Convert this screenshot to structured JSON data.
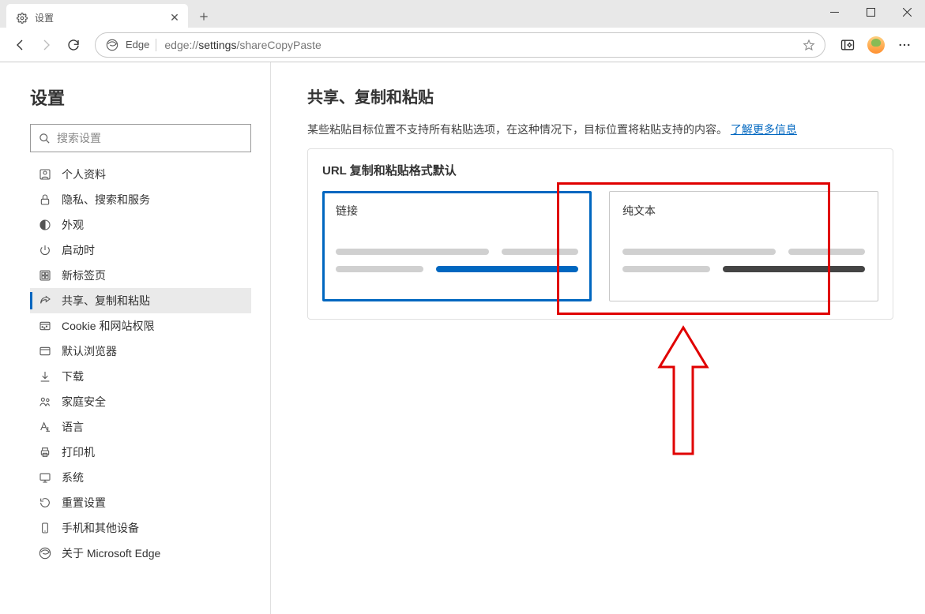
{
  "window": {
    "tab_title": "设置"
  },
  "toolbar": {
    "edge_label": "Edge",
    "url_prefix": "edge://",
    "url_bold": "settings",
    "url_suffix": "/shareCopyPaste"
  },
  "sidebar": {
    "title": "设置",
    "search_placeholder": "搜索设置",
    "items": [
      {
        "label": "个人资料",
        "icon": "profile"
      },
      {
        "label": "隐私、搜索和服务",
        "icon": "lock"
      },
      {
        "label": "外观",
        "icon": "appearance"
      },
      {
        "label": "启动时",
        "icon": "power"
      },
      {
        "label": "新标签页",
        "icon": "grid"
      },
      {
        "label": "共享、复制和粘贴",
        "icon": "share"
      },
      {
        "label": "Cookie 和网站权限",
        "icon": "cookie"
      },
      {
        "label": "默认浏览器",
        "icon": "browser"
      },
      {
        "label": "下载",
        "icon": "download"
      },
      {
        "label": "家庭安全",
        "icon": "family"
      },
      {
        "label": "语言",
        "icon": "language"
      },
      {
        "label": "打印机",
        "icon": "printer"
      },
      {
        "label": "系统",
        "icon": "system"
      },
      {
        "label": "重置设置",
        "icon": "reset"
      },
      {
        "label": "手机和其他设备",
        "icon": "phone"
      },
      {
        "label": "关于 Microsoft Edge",
        "icon": "about"
      }
    ]
  },
  "main": {
    "heading": "共享、复制和粘贴",
    "description": "某些粘贴目标位置不支持所有粘贴选项，在这种情况下，目标位置将粘贴支持的内容。",
    "learn_more": "了解更多信息",
    "card_title": "URL 复制和粘贴格式默认",
    "option_link": "链接",
    "option_plaintext": "纯文本"
  }
}
